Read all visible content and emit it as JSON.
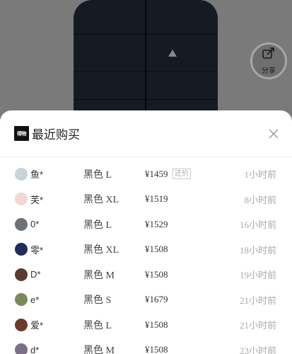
{
  "share": {
    "label": "分享",
    "icon": "share-icon"
  },
  "sheet": {
    "logo_text": "得物",
    "title": "最近购买",
    "close_icon": "close-icon"
  },
  "purchases": [
    {
      "name": "鱼*",
      "spec": "黑色 L",
      "price": "¥1459",
      "badge": "还价",
      "time": "1小时前",
      "avatar_color": "#c9d3dc"
    },
    {
      "name": "芙*",
      "spec": "黑色 XL",
      "price": "¥1519",
      "badge": "",
      "time": "8小时前",
      "avatar_color": "#f3d6d6"
    },
    {
      "name": "0*",
      "spec": "黑色 L",
      "price": "¥1529",
      "badge": "",
      "time": "16小时前",
      "avatar_color": "#6d7278"
    },
    {
      "name": "零*",
      "spec": "黑色 XL",
      "price": "¥1508",
      "badge": "",
      "time": "18小时前",
      "avatar_color": "#1d2c5a"
    },
    {
      "name": "D*",
      "spec": "黑色 M",
      "price": "¥1508",
      "badge": "",
      "time": "19小时前",
      "avatar_color": "#5c3b2e"
    },
    {
      "name": "e*",
      "spec": "黑色 S",
      "price": "¥1679",
      "badge": "",
      "time": "21小时前",
      "avatar_color": "#7a8a5a"
    },
    {
      "name": "爱*",
      "spec": "黑色 L",
      "price": "¥1508",
      "badge": "",
      "time": "21小时前",
      "avatar_color": "#6b3a2a"
    },
    {
      "name": "d*",
      "spec": "黑色 M",
      "price": "¥1508",
      "badge": "",
      "time": "23小时前",
      "avatar_color": "#7d6f8a"
    }
  ]
}
